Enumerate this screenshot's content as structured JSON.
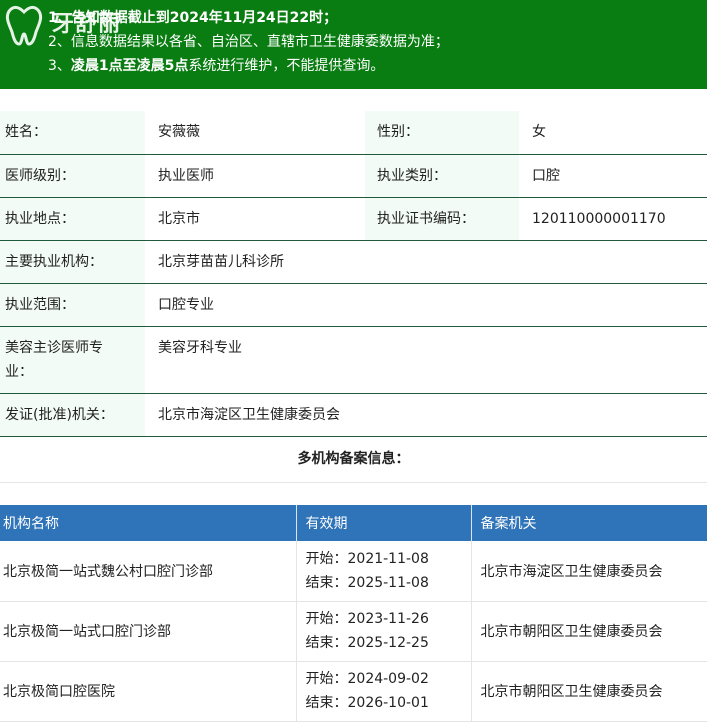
{
  "notice": {
    "line1": "1、告知数据截止到2024年11月24日22时；",
    "line2": "2、信息数据结果以各省、自治区、直辖市卫生健康委数据为准；",
    "line3_prefix": "3、",
    "line3_bold": "凌晨1点至凌晨5点",
    "line3_suffix": "系统进行维护，不能提供查询。",
    "bg_color": "#0a7d12"
  },
  "logo": {
    "brand": "牙舒丽",
    "icon": "tooth-icon"
  },
  "doctor": {
    "name_label": "姓名：",
    "name": "安薇薇",
    "gender_label": "性别：",
    "gender": "女",
    "level_label": "医师级别：",
    "level": "执业医师",
    "category_label": "执业类别：",
    "category": "口腔",
    "location_label": "执业地点：",
    "location": "北京市",
    "cert_label": "执业证书编码：",
    "cert": "120110000001170",
    "institution_label": "主要执业机构：",
    "institution": "北京芽苗苗儿科诊所",
    "scope_label": "执业范围：",
    "scope": "口腔专业",
    "cosmetic_label": "美容主诊医师专业：",
    "cosmetic": "美容牙科专业",
    "issuer_label": "发证(批准)机关：",
    "issuer": "北京市海淀区卫生健康委员会"
  },
  "multi": {
    "title": "多机构备案信息：",
    "headers": [
      "机构名称",
      "有效期",
      "备案机关"
    ],
    "rows": [
      {
        "name": "北京极简一站式魏公村口腔门诊部",
        "start": "开始：2021-11-08",
        "end": "结束：2025-11-08",
        "authority": "北京市海淀区卫生健康委员会"
      },
      {
        "name": "北京极简一站式口腔门诊部",
        "start": "开始：2023-11-26",
        "end": "结束：2025-12-25",
        "authority": "北京市朝阳区卫生健康委员会"
      },
      {
        "name": "北京极简口腔医院",
        "start": "开始：2024-09-02",
        "end": "结束：2026-10-01",
        "authority": "北京市朝阳区卫生健康委员会"
      }
    ],
    "header_color": "#2f73b8"
  }
}
